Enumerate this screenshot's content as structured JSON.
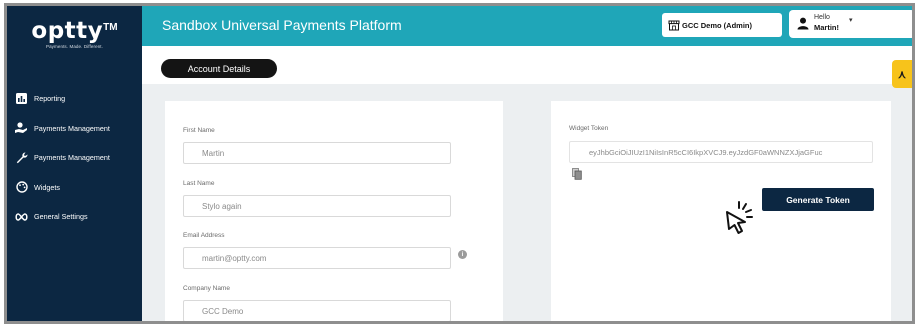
{
  "brand": {
    "logo_text": "optty",
    "logo_tm": "TM",
    "tagline": "Payments. Made. Different."
  },
  "sidebar": {
    "items": [
      {
        "label": "Reporting",
        "icon": "bar-chart-icon"
      },
      {
        "label": "Payments Management",
        "icon": "hand-coin-icon"
      },
      {
        "label": "Payments Management",
        "icon": "wrench-icon"
      },
      {
        "label": "Widgets",
        "icon": "palette-icon"
      },
      {
        "label": "General Settings",
        "icon": "infinity-icon"
      }
    ]
  },
  "topbar": {
    "title": "Sandbox Universal Payments Platform",
    "org_label": "GCC Demo (Admin)",
    "user_greeting": "Hello",
    "user_name": "Martin!"
  },
  "subbar": {
    "tab_label": "Account Details"
  },
  "form": {
    "first_name_label": "First Name",
    "first_name_value": "Martin",
    "last_name_label": "Last Name",
    "last_name_value": "Stylo again",
    "email_label": "Email Address",
    "email_value": "martin@optty.com",
    "company_label": "Company Name",
    "company_value": "GCC Demo"
  },
  "widget": {
    "token_label": "Widget Token",
    "token_value": "eyJhbGciOiJIUzI1NiIsInR5cCI6IkpXVCJ9.eyJzdGF0aWNNZXJjaGFuc",
    "generate_label": "Generate Token"
  },
  "colors": {
    "sidebar_bg": "#0c2742",
    "topbar_bg": "#1fa6b8",
    "accent_yellow": "#f7c31b",
    "button_bg": "#0c2742"
  }
}
